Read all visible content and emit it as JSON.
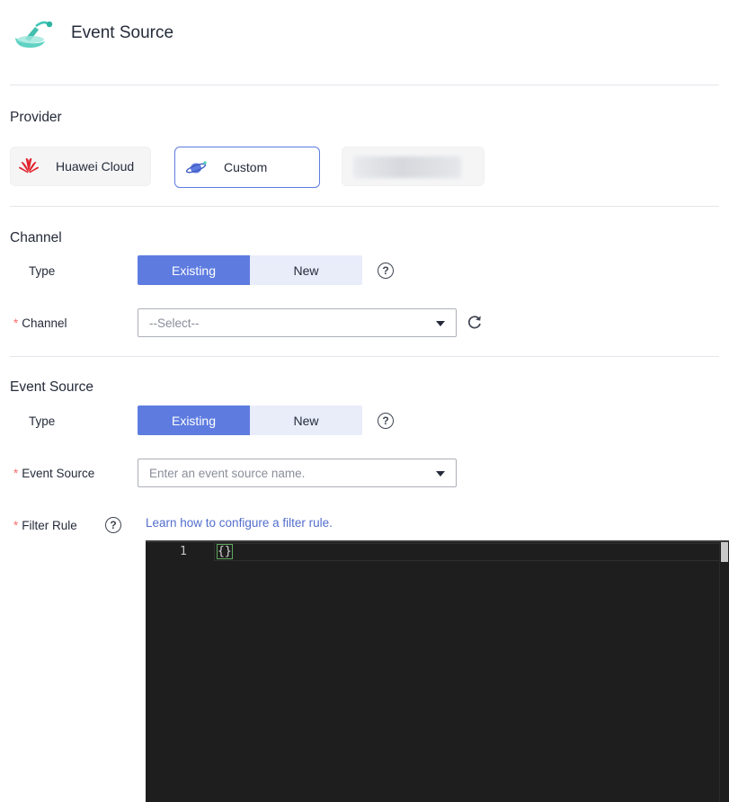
{
  "header": {
    "title": "Event Source",
    "icon": "event-source-satellite-icon"
  },
  "provider": {
    "section_title": "Provider",
    "options": [
      {
        "label": "Huawei Cloud",
        "icon": "huawei-logo-icon"
      },
      {
        "label": "Custom",
        "icon": "planet-icon",
        "selected": true
      }
    ]
  },
  "channel": {
    "section_title": "Channel",
    "type_label": "Type",
    "type_options": [
      "Existing",
      "New"
    ],
    "type_selected": "Existing",
    "channel_label": "Channel",
    "channel_placeholder": "--Select--"
  },
  "event_source": {
    "section_title": "Event Source",
    "type_label": "Type",
    "type_options": [
      "Existing",
      "New"
    ],
    "type_selected": "Existing",
    "source_label": "Event Source",
    "source_placeholder": "Enter an event source name.",
    "filter_label": "Filter Rule",
    "filter_link": "Learn how to configure a filter rule.",
    "editor": {
      "line_number": "1",
      "code": "{}"
    }
  },
  "colors": {
    "accent": "#5e7ce0",
    "required": "#f66f6a",
    "link": "#526ecc",
    "editor_bg": "#1e1e1e"
  }
}
